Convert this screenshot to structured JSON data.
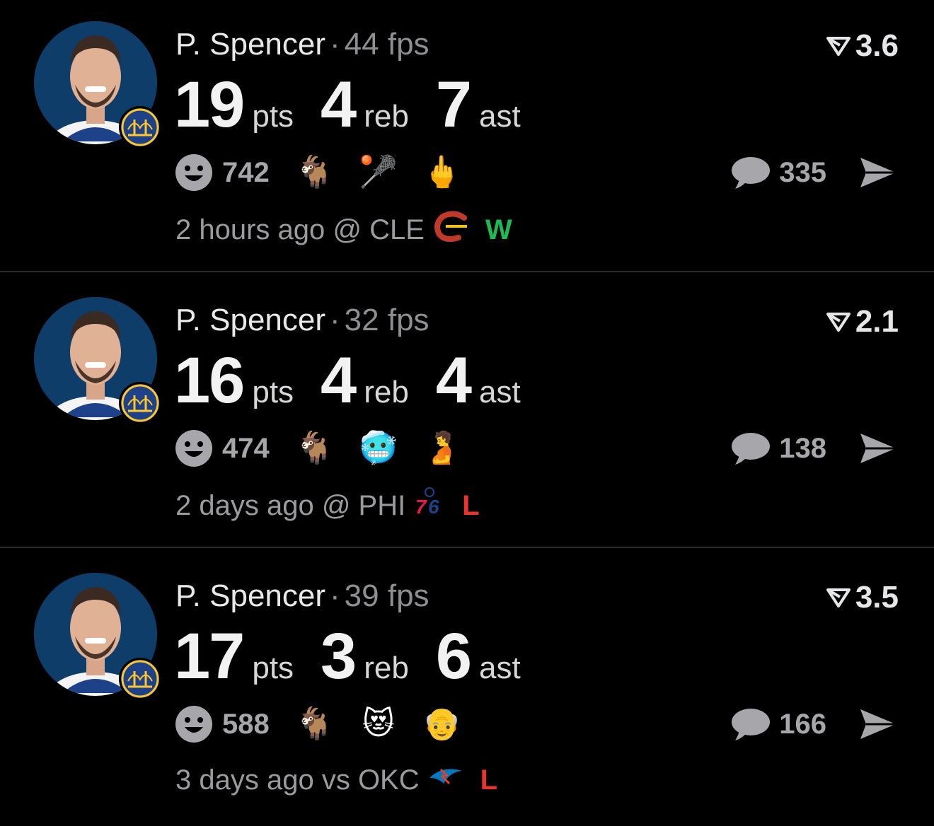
{
  "feed": [
    {
      "player": "P. Spencer",
      "fps": "44 fps",
      "rating": "3.6",
      "pts": "19",
      "pts_label": "pts",
      "reb": "4",
      "reb_label": "reb",
      "ast": "7",
      "ast_label": "ast",
      "reaction_count": "742",
      "emojis": [
        "🐐",
        "🥍",
        "🖕"
      ],
      "comment_count": "335",
      "time": "2 hours ago",
      "venue": "@ CLE",
      "result": "W",
      "result_color": "#1db954",
      "opponent_logo": "cavaliers-logo"
    },
    {
      "player": "P. Spencer",
      "fps": "32 fps",
      "rating": "2.1",
      "pts": "16",
      "pts_label": "pts",
      "reb": "4",
      "reb_label": "reb",
      "ast": "4",
      "ast_label": "ast",
      "reaction_count": "474",
      "emojis": [
        "🐐",
        "🥶",
        "🫄"
      ],
      "comment_count": "138",
      "time": "2 days ago",
      "venue": "@ PHI",
      "result": "L",
      "result_color": "#e8332e",
      "opponent_logo": "76ers-logo"
    },
    {
      "player": "P. Spencer",
      "fps": "39 fps",
      "rating": "3.5",
      "pts": "17",
      "pts_label": "pts",
      "reb": "3",
      "reb_label": "reb",
      "ast": "6",
      "ast_label": "ast",
      "reaction_count": "588",
      "emojis": [
        "🐐",
        "😻",
        "👴"
      ],
      "comment_count": "166",
      "time": "3 days ago",
      "venue": "vs OKC",
      "result": "L",
      "result_color": "#e8332e",
      "opponent_logo": "thunder-logo"
    }
  ],
  "icons": {
    "separator": "·",
    "smiley": "smiley-icon",
    "comment": "comment-bubble-icon",
    "share": "send-icon",
    "rating": "rating-arrow-icon",
    "team_badge": "warriors-logo"
  }
}
